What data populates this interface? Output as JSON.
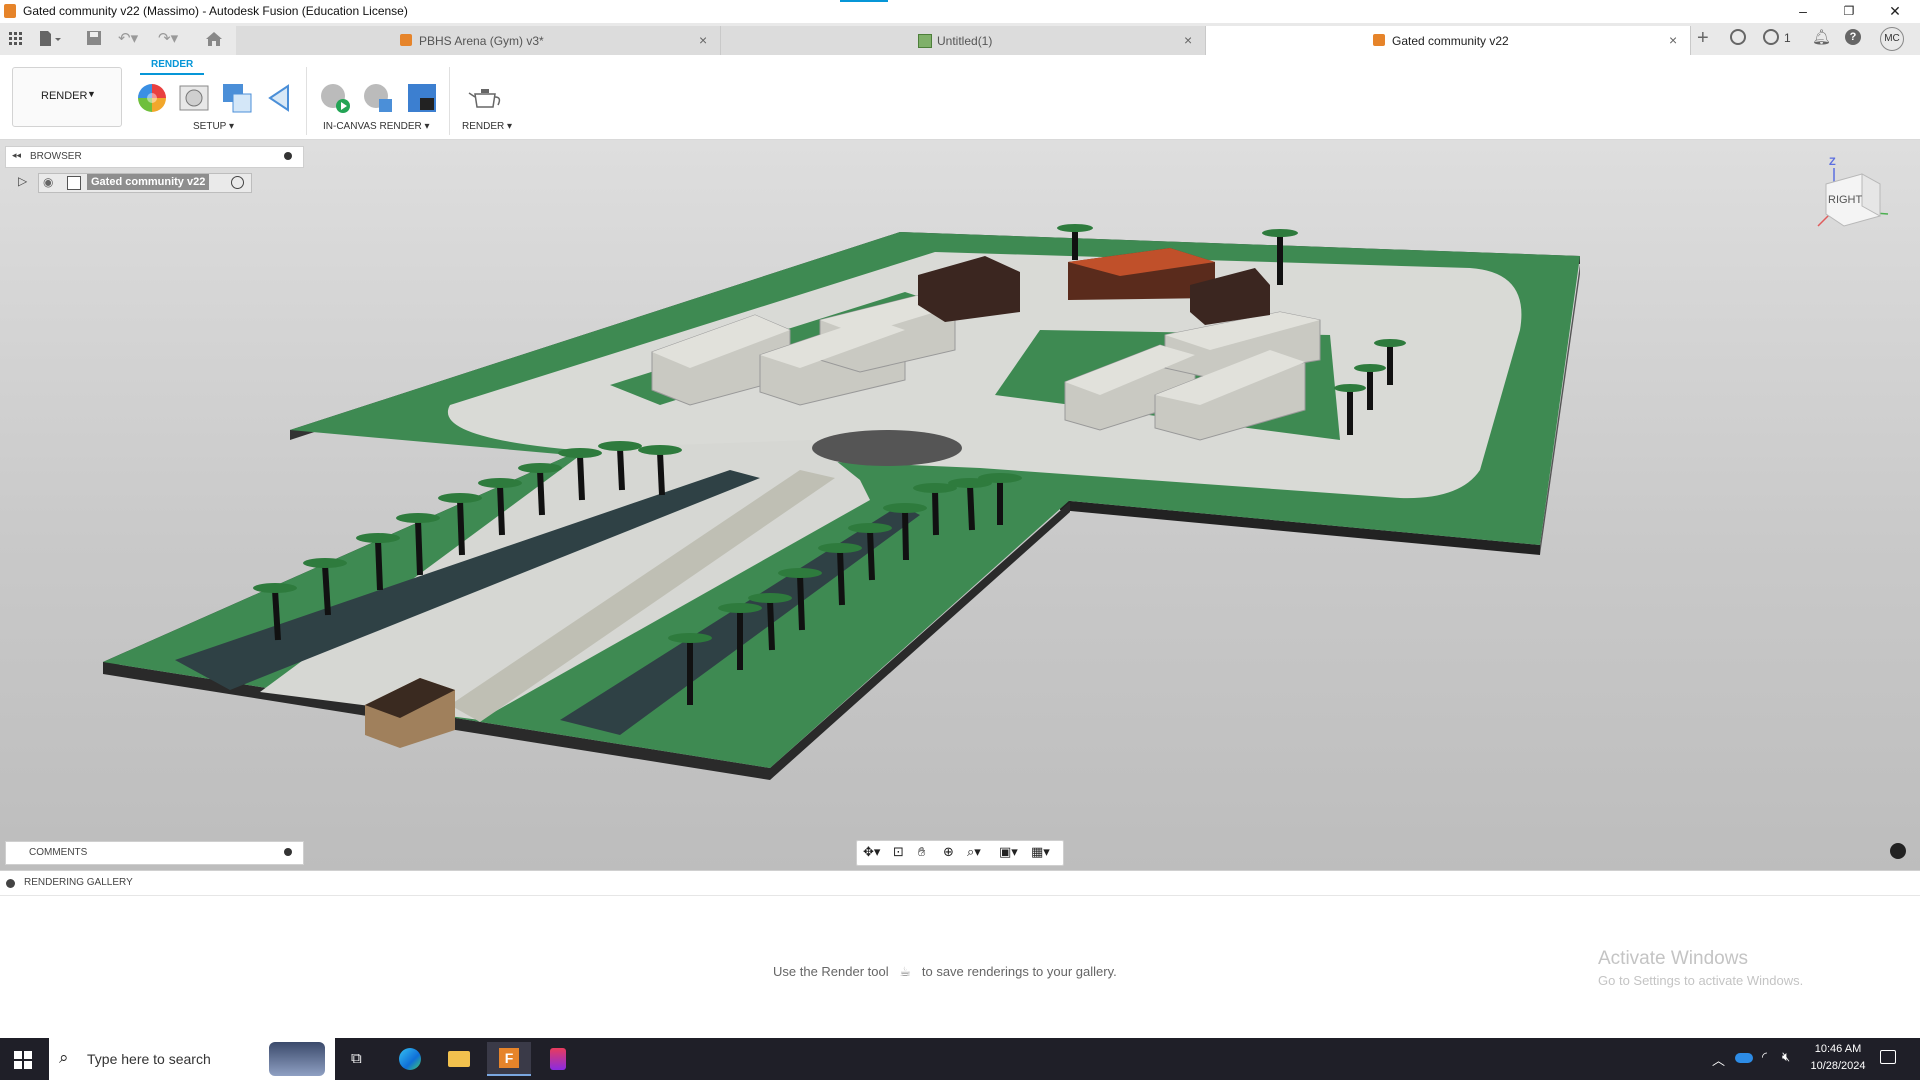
{
  "window": {
    "title": "Gated community v22 (Massimo) - Autodesk Fusion (Education License)"
  },
  "tabs": [
    {
      "label": "PBHS Arena (Gym) v3*",
      "active": false
    },
    {
      "label": "Untitled(1)",
      "active": false
    },
    {
      "label": "Gated community v22",
      "active": true
    }
  ],
  "header": {
    "job_count": "1",
    "user_initials": "MC"
  },
  "ribbon": {
    "active_tab": "RENDER",
    "workspace_button": "RENDER",
    "groups": {
      "setup": "SETUP",
      "in_canvas": "IN-CANVAS RENDER",
      "render": "RENDER"
    }
  },
  "browser": {
    "title": "BROWSER",
    "root_item": "Gated community v22"
  },
  "viewcube": {
    "face_label": "RIGHT",
    "z_label": "Z"
  },
  "comments": {
    "title": "COMMENTS"
  },
  "gallery": {
    "title": "RENDERING GALLERY",
    "hint_before": "Use the Render tool",
    "hint_after": "to save renderings to your gallery."
  },
  "watermark": {
    "line1": "Activate Windows",
    "line2": "Go to Settings to activate Windows."
  },
  "taskbar": {
    "search_placeholder": "Type here to search",
    "time": "10:46 AM",
    "date": "10/28/2024"
  },
  "colors": {
    "accent_blue": "#0696d7",
    "grass": "#3e8a52",
    "pavement": "#d9dad6",
    "taskbar": "#1f1f28"
  }
}
